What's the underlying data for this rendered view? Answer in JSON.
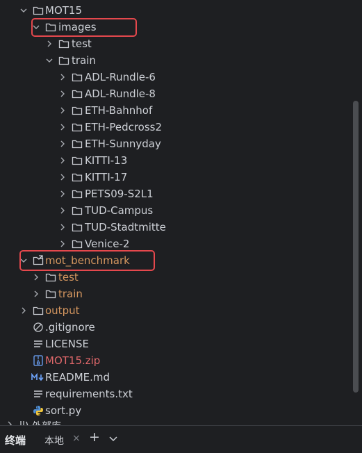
{
  "colors": {
    "background": "#1e1f22",
    "text": "#cdd0d6",
    "excluded_text": "#d4965f",
    "archive_text": "#e0686b",
    "highlight_border": "#e5484d"
  },
  "tree": {
    "mot15": "MOT15",
    "images": "images",
    "images_test": "test",
    "images_train": "train",
    "train_items": [
      "ADL-Rundle-6",
      "ADL-Rundle-8",
      "ETH-Bahnhof",
      "ETH-Pedcross2",
      "ETH-Sunnyday",
      "KITTI-13",
      "KITTI-17",
      "PETS09-S2L1",
      "TUD-Campus",
      "TUD-Stadtmitte",
      "Venice-2"
    ],
    "mot_benchmark": "mot_benchmark",
    "benchmark_test": "test",
    "benchmark_train": "train",
    "output": "output",
    "gitignore": ".gitignore",
    "license": "LICENSE",
    "zip": "MOT15.zip",
    "readme": "README.md",
    "requirements": "requirements.txt",
    "sort": "sort.py",
    "external_libraries": "外部库"
  },
  "icons": {
    "folder": "folder-icon",
    "link_folder": "link-folder-icon",
    "chevron_right": "chevron-right-icon",
    "chevron_down": "chevron-down-icon",
    "gitignore": "gitignore-icon",
    "text_file": "text-file-icon",
    "zip": "zip-icon",
    "markdown": "markdown-icon",
    "python": "python-icon"
  },
  "bottom_bar": {
    "title": "终端",
    "tab_label": "本地",
    "close_glyph": "×",
    "add_glyph": "+"
  }
}
